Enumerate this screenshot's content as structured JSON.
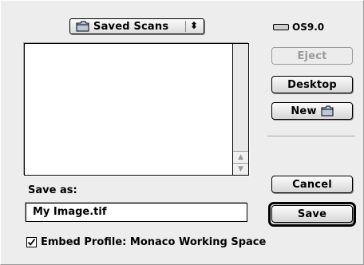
{
  "folder_popup": {
    "label": "Saved Scans",
    "arrows": "⬍"
  },
  "disk": {
    "name": "OS9.0"
  },
  "buttons": {
    "eject": "Eject",
    "desktop": "Desktop",
    "new": "New",
    "cancel": "Cancel",
    "save": "Save"
  },
  "save_as": {
    "label": "Save as:",
    "filename": "My Image.tif"
  },
  "embed_profile": {
    "label": "Embed Profile: Monaco Working Space",
    "checked": true
  },
  "icons": {
    "folder": "folder-icon",
    "disk": "disk-icon",
    "scroll_up": "scroll-up-arrow-icon",
    "scroll_down": "scroll-down-arrow-icon",
    "checkmark": "checkmark-icon"
  },
  "colors": {
    "dialog_bg": "#ededed",
    "disabled_text": "#9a9a9a"
  }
}
